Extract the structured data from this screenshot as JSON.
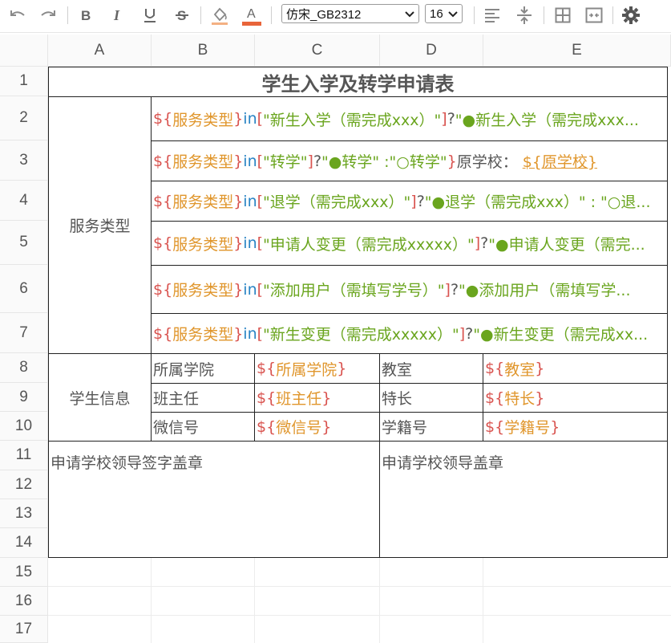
{
  "toolbar": {
    "font_name": "仿宋_GB2312",
    "font_size": "16",
    "colors": {
      "fill_accent": "#f4b183",
      "text_accent": "#e8643a"
    },
    "icons": [
      "undo-icon",
      "redo-icon",
      "bold-icon",
      "italic-icon",
      "underline-icon",
      "strikethrough-icon",
      "fill-color-icon",
      "font-color-icon",
      "align-left-icon",
      "vertical-align-icon",
      "borders-icon",
      "merge-cells-icon",
      "settings-icon"
    ],
    "font_color_letter": "A"
  },
  "columns": [
    "A",
    "B",
    "C",
    "D",
    "E"
  ],
  "rows": [
    "1",
    "2",
    "3",
    "4",
    "5",
    "6",
    "7",
    "8",
    "9",
    "10",
    "11",
    "12",
    "13",
    "14",
    "15",
    "16",
    "17"
  ],
  "sheet": {
    "title": "学生入学及转学申请表",
    "service_type_label": "服务类型",
    "student_info_label": "学生信息",
    "service_rows": [
      {
        "pre": "${",
        "field": "服务类型",
        "post": "}",
        "kw": " in ",
        "lb": "[",
        "str": "\"新生入学（需完成xxx）\"",
        "rb": "]",
        "q": " ? ",
        "opt": "\"●新生入学（需完成xxx..."
      },
      {
        "pre": "${",
        "field": "服务类型",
        "post": "}",
        "kw": " in ",
        "lb": "[",
        "str": " \"转学\"",
        "rb": "]",
        "q": " ? ",
        "opt": "\"●转学\" :\"○转学\"",
        "close": "}",
        "extra": " 原学校：",
        "ref": "${原学校}"
      },
      {
        "pre": "${",
        "field": "服务类型",
        "post": "}",
        "kw": " in ",
        "lb": "[",
        "str": "\"退学（需完成xxx）\"",
        "rb": "]",
        "q": " ? ",
        "opt": "\"●退学（需完成xxx）\" : \"○退..."
      },
      {
        "pre": "${",
        "field": "服务类型",
        "post": "}",
        "kw": " in ",
        "lb": "[",
        "str": "\"申请人变更（需完成xxxxx）\"",
        "rb": "]",
        "q": " ? ",
        "opt": "\"●申请人变更（需完..."
      },
      {
        "pre": "${",
        "field": "服务类型",
        "post": "}",
        "kw": " in ",
        "lb": "[",
        "str": "\"添加用户（需填写学号）\"",
        "rb": "]",
        "q": " ? ",
        "opt": "\"●添加用户（需填写学..."
      },
      {
        "pre": "${",
        "field": "服务类型",
        "post": "}",
        "kw": " in ",
        "lb": "[",
        "str": "\"新生变更（需完成xxxxx）\"",
        "rb": "]",
        "q": " ? ",
        "opt": "\"●新生变更（需完成xx..."
      }
    ],
    "info_rows": [
      {
        "label1": "所属学院",
        "pre1": "${",
        "var1": "所属学院",
        "post1": "}",
        "label2": "教室",
        "pre2": "${",
        "var2": "教室",
        "post2": "}"
      },
      {
        "label1": "班主任",
        "pre1": "${",
        "var1": "班主任",
        "post1": "}",
        "label2": "特长",
        "pre2": "${",
        "var2": "特长",
        "post2": "}"
      },
      {
        "label1": "微信号",
        "pre1": "${",
        "var1": "微信号",
        "post1": "}",
        "label2": "学籍号",
        "pre2": "${",
        "var2": "学籍号",
        "post2": "}"
      }
    ],
    "sign_left": "申请学校领导签字盖章",
    "sign_right": "申请学校领导盖章"
  }
}
